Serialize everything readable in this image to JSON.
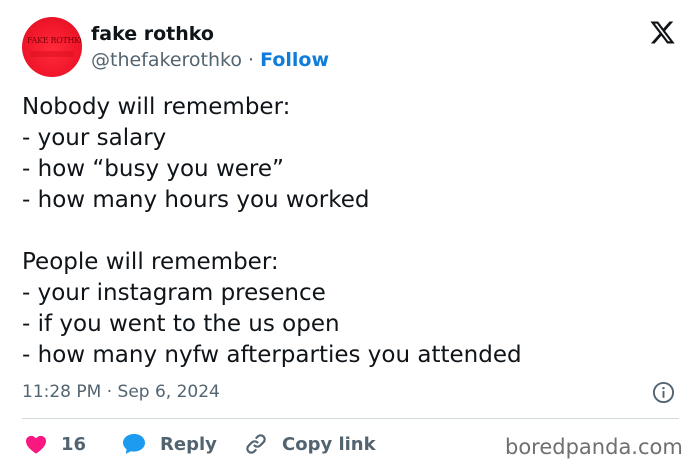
{
  "author": {
    "avatar_text": "FAKE ROTHKO",
    "display_name": "fake rothko",
    "handle": "@thefakerothko",
    "separator": " · ",
    "follow_label": "Follow"
  },
  "post": {
    "text": "Nobody will remember:\n- your salary\n- how “busy you were”\n- how many hours you worked\n\nPeople will remember:\n- your instagram presence\n- if you went to the us open\n- how many nyfw afterparties you attended",
    "timestamp": "11:28 PM · Sep 6, 2024"
  },
  "actions": {
    "like_count": "16",
    "reply_label": "Reply",
    "copy_link_label": "Copy link"
  },
  "watermark": "boredpanda.com",
  "colors": {
    "accent": "#0f7ddb",
    "like": "#f91880",
    "reply": "#1d9bf0",
    "muted": "#536471",
    "avatar": "#f0162a"
  },
  "icons": {
    "logo": "x-logo-icon",
    "info": "info-icon",
    "like": "heart-icon",
    "reply": "speech-bubble-icon",
    "copy": "link-icon"
  }
}
